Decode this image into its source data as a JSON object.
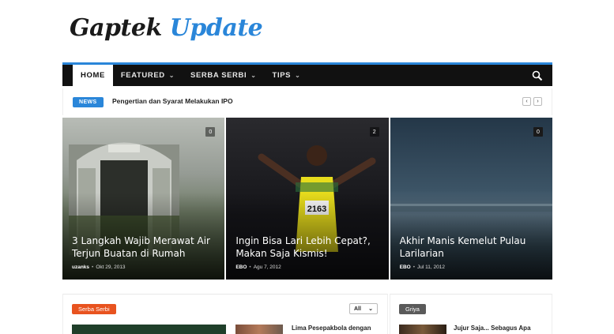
{
  "logo": {
    "part1": "Gaptek",
    "part2": "Update"
  },
  "nav": {
    "items": [
      {
        "label": "HOME",
        "active": true,
        "dropdown": false
      },
      {
        "label": "FEATURED",
        "active": false,
        "dropdown": true
      },
      {
        "label": "SERBA SERBI",
        "active": false,
        "dropdown": true
      },
      {
        "label": "TIPS",
        "active": false,
        "dropdown": true
      }
    ],
    "search_icon": "search-icon"
  },
  "ticker": {
    "badge": "NEWS",
    "headline": "Pengertian dan Syarat Melakukan IPO",
    "prev": "‹",
    "next": "›"
  },
  "slides": [
    {
      "title": "3 Langkah Wajib Merawat Air Terjun Buatan di Rumah",
      "author": "uzanks",
      "date": "Okt 29, 2013",
      "comments": "0"
    },
    {
      "title": "Ingin Bisa Lari Lebih Cepat?, Makan Saja Kismis!",
      "author": "EBO",
      "date": "Agu 7, 2012",
      "comments": "2"
    },
    {
      "title": "Akhir Manis Kemelut Pulau Larilarian",
      "author": "EBO",
      "date": "Jul 11, 2012",
      "comments": "0"
    }
  ],
  "section_left": {
    "category": "Serba Serbi",
    "filter": "All",
    "post_title": "Lima Pesepakbola dengan"
  },
  "section_right": {
    "category": "Griya",
    "post_title": "Jujur Saja... Sebagus Apa"
  },
  "colors": {
    "accent": "#2a86d9",
    "nav_bg": "#111111",
    "serba_serbi": "#e8531f",
    "griya": "#5a5a5a"
  }
}
